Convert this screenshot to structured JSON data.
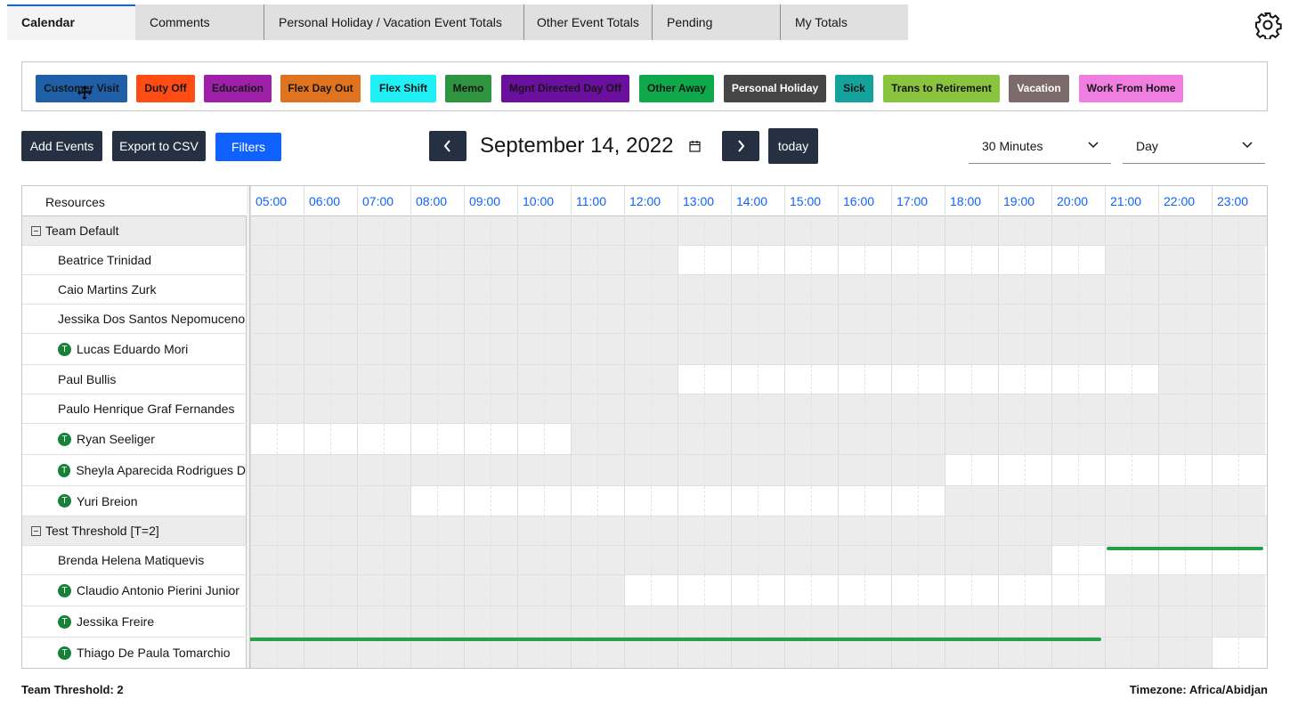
{
  "tabs": [
    {
      "label": "Calendar",
      "active": true
    },
    {
      "label": "Comments"
    },
    {
      "label": "Personal Holiday / Vacation Event Totals"
    },
    {
      "label": "Other Event Totals"
    },
    {
      "label": "Pending"
    },
    {
      "label": "My Totals"
    }
  ],
  "legend": [
    {
      "label": "Customer Visit",
      "bg": "#1f5fa8",
      "fg": "#161616"
    },
    {
      "label": "Duty Off",
      "bg": "#ff4c14",
      "fg": "#161616"
    },
    {
      "label": "Education",
      "bg": "#9e1fa8",
      "fg": "#161616"
    },
    {
      "label": "Flex Day Out",
      "bg": "#e0731f",
      "fg": "#161616"
    },
    {
      "label": "Flex Shift",
      "bg": "#1ff0f5",
      "fg": "#161616"
    },
    {
      "label": "Memo",
      "bg": "#2e9440",
      "fg": "#161616"
    },
    {
      "label": "Mgnt Directed Day Off",
      "bg": "#6b0f9e",
      "fg": "#161616"
    },
    {
      "label": "Other Away",
      "bg": "#0fa84a",
      "fg": "#161616"
    },
    {
      "label": "Personal Holiday",
      "bg": "#464646",
      "fg": "#ffffff"
    },
    {
      "label": "Sick",
      "bg": "#13a39b",
      "fg": "#161616"
    },
    {
      "label": "Trans to Retirement",
      "bg": "#8ac43f",
      "fg": "#161616"
    },
    {
      "label": "Vacation",
      "bg": "#7d6b6b",
      "fg": "#ffffff"
    },
    {
      "label": "Work From Home",
      "bg": "#f07ee0",
      "fg": "#161616"
    }
  ],
  "toolbar": {
    "add_events": "Add Events",
    "export_csv": "Export to CSV",
    "filters": "Filters",
    "date_title": "September 14, 2022",
    "today": "today",
    "interval": "30 Minutes",
    "view": "Day"
  },
  "grid": {
    "resources_header": "Resources",
    "hours": [
      "05:00",
      "06:00",
      "07:00",
      "08:00",
      "09:00",
      "10:00",
      "11:00",
      "12:00",
      "13:00",
      "14:00",
      "15:00",
      "16:00",
      "17:00",
      "18:00",
      "19:00",
      "20:00",
      "21:00",
      "22:00",
      "23:00"
    ],
    "rows": [
      {
        "type": "group",
        "name": "Team Default"
      },
      {
        "type": "res",
        "name": "Beatrice Trinidad",
        "badge": "",
        "on": [
          [
            13,
            21
          ]
        ]
      },
      {
        "type": "res",
        "name": "Caio Martins Zurk",
        "badge": "",
        "on": []
      },
      {
        "type": "res",
        "name": "Jessika Dos Santos Nepomuceno",
        "badge": "",
        "on": []
      },
      {
        "type": "res",
        "name": "Lucas Eduardo Mori",
        "badge": "T",
        "on": []
      },
      {
        "type": "res",
        "name": "Paul Bullis",
        "badge": "",
        "on": [
          [
            13,
            22
          ]
        ]
      },
      {
        "type": "res",
        "name": "Paulo Henrique Graf Fernandes",
        "badge": "",
        "on": []
      },
      {
        "type": "res",
        "name": "Ryan Seeliger",
        "badge": "T",
        "on": [
          [
            5,
            11
          ]
        ]
      },
      {
        "type": "res",
        "name": "Sheyla Aparecida Rodrigues D",
        "badge": "T",
        "on": [
          [
            18,
            24
          ]
        ]
      },
      {
        "type": "res",
        "name": "Yuri Breion",
        "badge": "T",
        "on": [
          [
            8,
            18
          ]
        ]
      },
      {
        "type": "group",
        "name": "Test Threshold [T=2]"
      },
      {
        "type": "res",
        "name": "Brenda Helena Matiquevis",
        "badge": "",
        "on": [
          [
            20,
            24
          ]
        ],
        "bar": [
          21,
          24
        ]
      },
      {
        "type": "res",
        "name": "Claudio Antonio Pierini Junior",
        "badge": "T",
        "on": [
          [
            12,
            21
          ]
        ]
      },
      {
        "type": "res",
        "name": "Jessika Freire",
        "badge": "T",
        "on": []
      },
      {
        "type": "res",
        "name": "Thiago De Paula Tomarchio",
        "badge": "T",
        "on": [
          [
            23,
            24
          ]
        ],
        "bar": [
          5,
          21
        ]
      }
    ]
  },
  "footer": {
    "threshold": "Team Threshold: 2",
    "timezone": "Timezone: Africa/Abidjan"
  }
}
